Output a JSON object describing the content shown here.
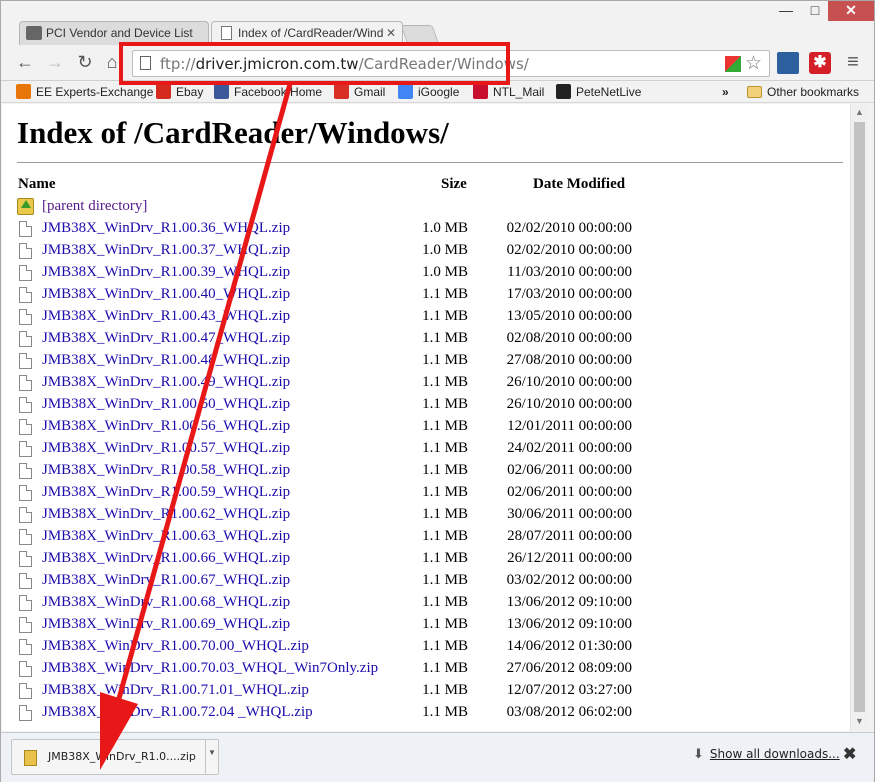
{
  "tabs": [
    {
      "label": "PCI Vendor and Device List",
      "active": false
    },
    {
      "label": "Index of /CardReader/Wind",
      "active": true
    }
  ],
  "window": {
    "minimize": "—",
    "maximize": "□",
    "close": "✕"
  },
  "toolbar": {
    "back": "←",
    "forward": "→",
    "reload": "↻",
    "home": "⌂",
    "url_scheme": "ftp://",
    "url_host": "driver.jmicron.com.tw",
    "url_path": "/CardReader/Windows/",
    "star": "☆",
    "menu": "≡"
  },
  "bookmarks": [
    {
      "label": "EE Experts-Exchange",
      "icon": "ee-icon",
      "color": "#e8760a"
    },
    {
      "label": "Ebay",
      "icon": "ebay-icon",
      "color": "#d52b1e"
    },
    {
      "label": "Facebook Home",
      "icon": "facebook-icon",
      "color": "#3b5998"
    },
    {
      "label": "Gmail",
      "icon": "gmail-icon",
      "color": "#d93025"
    },
    {
      "label": "iGoogle",
      "icon": "igoogle-icon",
      "color": "#4285f4"
    },
    {
      "label": "NTL_Mail",
      "icon": "ntl-icon",
      "color": "#c8102e"
    },
    {
      "label": "PeteNetLive",
      "icon": "petenetlive-icon",
      "color": "#222222"
    }
  ],
  "bookmarks_overflow": "»",
  "other_bookmarks": "Other bookmarks",
  "page": {
    "title": "Index of /CardReader/Windows/",
    "col_name": "Name",
    "col_size": "Size",
    "col_date": "Date Modified",
    "parent": "[parent directory]",
    "files": [
      {
        "name": "JMB38X_WinDrv_R1.00.36_WHQL.zip",
        "size": "1.0 MB",
        "date": "02/02/2010 00:00:00"
      },
      {
        "name": "JMB38X_WinDrv_R1.00.37_WHQL.zip",
        "size": "1.0 MB",
        "date": "02/02/2010 00:00:00"
      },
      {
        "name": "JMB38X_WinDrv_R1.00.39_WHQL.zip",
        "size": "1.0 MB",
        "date": "11/03/2010 00:00:00"
      },
      {
        "name": "JMB38X_WinDrv_R1.00.40_WHQL.zip",
        "size": "1.1 MB",
        "date": "17/03/2010 00:00:00"
      },
      {
        "name": "JMB38X_WinDrv_R1.00.43_WHQL.zip",
        "size": "1.1 MB",
        "date": "13/05/2010 00:00:00"
      },
      {
        "name": "JMB38X_WinDrv_R1.00.47_WHQL.zip",
        "size": "1.1 MB",
        "date": "02/08/2010 00:00:00"
      },
      {
        "name": "JMB38X_WinDrv_R1.00.48_WHQL.zip",
        "size": "1.1 MB",
        "date": "27/08/2010 00:00:00"
      },
      {
        "name": "JMB38X_WinDrv_R1.00.49_WHQL.zip",
        "size": "1.1 MB",
        "date": "26/10/2010 00:00:00"
      },
      {
        "name": "JMB38X_WinDrv_R1.00.50_WHQL.zip",
        "size": "1.1 MB",
        "date": "26/10/2010 00:00:00"
      },
      {
        "name": "JMB38X_WinDrv_R1.00.56_WHQL.zip",
        "size": "1.1 MB",
        "date": "12/01/2011 00:00:00"
      },
      {
        "name": "JMB38X_WinDrv_R1.00.57_WHQL.zip",
        "size": "1.1 MB",
        "date": "24/02/2011 00:00:00"
      },
      {
        "name": "JMB38X_WinDrv_R1.00.58_WHQL.zip",
        "size": "1.1 MB",
        "date": "02/06/2011 00:00:00"
      },
      {
        "name": "JMB38X_WinDrv_R1.00.59_WHQL.zip",
        "size": "1.1 MB",
        "date": "02/06/2011 00:00:00"
      },
      {
        "name": "JMB38X_WinDrv_R1.00.62_WHQL.zip",
        "size": "1.1 MB",
        "date": "30/06/2011 00:00:00"
      },
      {
        "name": "JMB38X_WinDrv_R1.00.63_WHQL.zip",
        "size": "1.1 MB",
        "date": "28/07/2011 00:00:00"
      },
      {
        "name": "JMB38X_WinDrv_R1.00.66_WHQL.zip",
        "size": "1.1 MB",
        "date": "26/12/2011 00:00:00"
      },
      {
        "name": "JMB38X_WinDrv_R1.00.67_WHQL.zip",
        "size": "1.1 MB",
        "date": "03/02/2012 00:00:00"
      },
      {
        "name": "JMB38X_WinDrv_R1.00.68_WHQL.zip",
        "size": "1.1 MB",
        "date": "13/06/2012 09:10:00"
      },
      {
        "name": "JMB38X_WinDrv_R1.00.69_WHQL.zip",
        "size": "1.1 MB",
        "date": "13/06/2012 09:10:00"
      },
      {
        "name": "JMB38X_WinDrv_R1.00.70.00_WHQL.zip",
        "size": "1.1 MB",
        "date": "14/06/2012 01:30:00"
      },
      {
        "name": "JMB38X_WinDrv_R1.00.70.03_WHQL_Win7Only.zip",
        "size": "1.1 MB",
        "date": "27/06/2012 08:09:00"
      },
      {
        "name": "JMB38X_WinDrv_R1.00.71.01_WHQL.zip",
        "size": "1.1 MB",
        "date": "12/07/2012 03:27:00"
      },
      {
        "name": "JMB38X_WinDrv_R1.00.72.04 _WHQL.zip",
        "size": "1.1 MB",
        "date": "03/08/2012 06:02:00"
      }
    ]
  },
  "download_shelf": {
    "item_name": "JMB38X_WinDrv_R1.0....zip",
    "show_all": "Show all downloads...",
    "close": "✖"
  },
  "colors": {
    "annotation": "#e81818",
    "link": "#1a0dab",
    "visited": "#551a8b"
  }
}
